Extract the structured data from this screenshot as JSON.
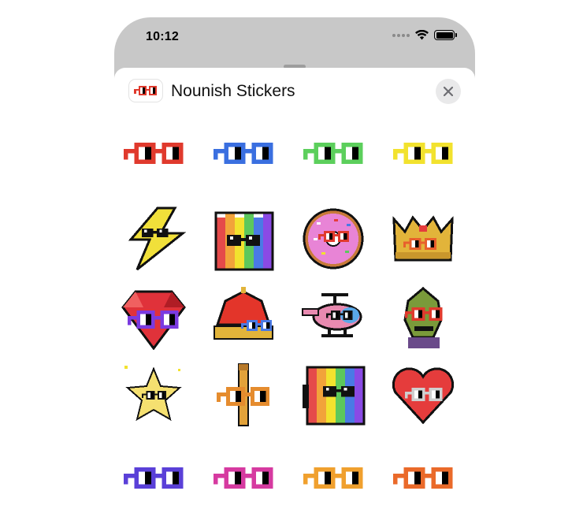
{
  "status_bar": {
    "time": "10:12",
    "icons": [
      "signal-icon",
      "wifi-icon",
      "battery-icon"
    ]
  },
  "sheet": {
    "title": "Nounish Stickers",
    "app_icon": "noggles-app-icon",
    "close_icon": "close-icon"
  },
  "stickers": [
    {
      "name": "red-noggles",
      "kind": "noggles",
      "color": "#e03a2d"
    },
    {
      "name": "blue-noggles",
      "kind": "noggles",
      "color": "#3a6fe0"
    },
    {
      "name": "green-noggles",
      "kind": "noggles",
      "color": "#5ccf5c"
    },
    {
      "name": "yellow-noggles",
      "kind": "noggles",
      "color": "#f2e22e"
    },
    {
      "name": "lightning-noggles",
      "kind": "lightning",
      "color": "#f1e03a"
    },
    {
      "name": "rainbow-block-noggles",
      "kind": "rainbow-block",
      "color": "#e54a4a"
    },
    {
      "name": "donut-noggles",
      "kind": "donut",
      "color": "#e884d6"
    },
    {
      "name": "crown-noggles",
      "kind": "crown",
      "color": "#e2b43a"
    },
    {
      "name": "gem-noggles",
      "kind": "gem",
      "color": "#e0323a"
    },
    {
      "name": "red-crown-noggles",
      "kind": "red-crown",
      "color": "#e3352a"
    },
    {
      "name": "helicopter-noggles",
      "kind": "helicopter",
      "color": "#e88ab0"
    },
    {
      "name": "zombie-noggles",
      "kind": "zombie",
      "color": "#7a9a3a"
    },
    {
      "name": "star-noggles",
      "kind": "star",
      "color": "#f5e070"
    },
    {
      "name": "pencil-noggles",
      "kind": "pencil",
      "color": "#e58c2e"
    },
    {
      "name": "rainbow-flag-noggles",
      "kind": "rainbow-flag",
      "color": "#e54a4a"
    },
    {
      "name": "heart-noggles",
      "kind": "heart",
      "color": "#e53c3c"
    },
    {
      "name": "purple-noggles",
      "kind": "noggles",
      "color": "#5a40d8"
    },
    {
      "name": "pink-noggles",
      "kind": "noggles",
      "color": "#d63aa0"
    },
    {
      "name": "orange-noggles",
      "kind": "noggles",
      "color": "#f0a02e"
    },
    {
      "name": "dark-orange-noggles",
      "kind": "noggles",
      "color": "#ea6a2a"
    }
  ]
}
